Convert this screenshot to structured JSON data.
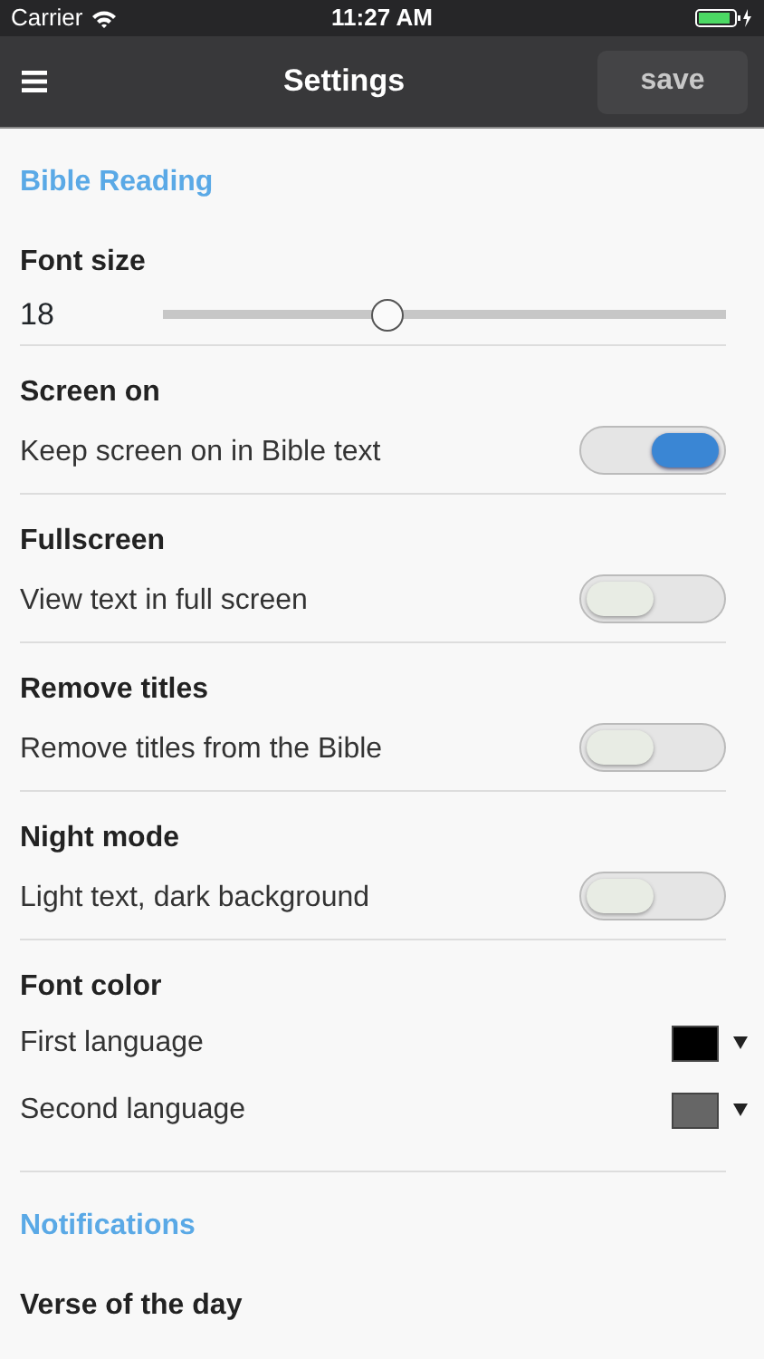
{
  "status_bar": {
    "carrier": "Carrier",
    "time": "11:27 AM"
  },
  "header": {
    "title": "Settings",
    "save_button": "save"
  },
  "sections": [
    {
      "title": "Bible Reading",
      "items": [
        {
          "kind": "slider",
          "title": "Font size",
          "value": "18",
          "level": 0.4
        },
        {
          "kind": "toggle",
          "title": "Screen on",
          "description": "Keep screen on in Bible text",
          "on": true
        },
        {
          "kind": "toggle",
          "title": "Fullscreen",
          "description": "View text in full screen",
          "on": false
        },
        {
          "kind": "toggle",
          "title": "Remove titles",
          "description": "Remove titles from the Bible",
          "on": false
        },
        {
          "kind": "toggle",
          "title": "Night mode",
          "description": "Light text, dark background",
          "on": false
        },
        {
          "kind": "colors",
          "title": "Font color",
          "rows": [
            {
              "label": "First language",
              "color": "#000000"
            },
            {
              "label": "Second language",
              "color": "#666666"
            }
          ]
        }
      ]
    },
    {
      "title": "Notifications",
      "items": [
        {
          "kind": "title",
          "title": "Verse of the day"
        }
      ]
    }
  ]
}
